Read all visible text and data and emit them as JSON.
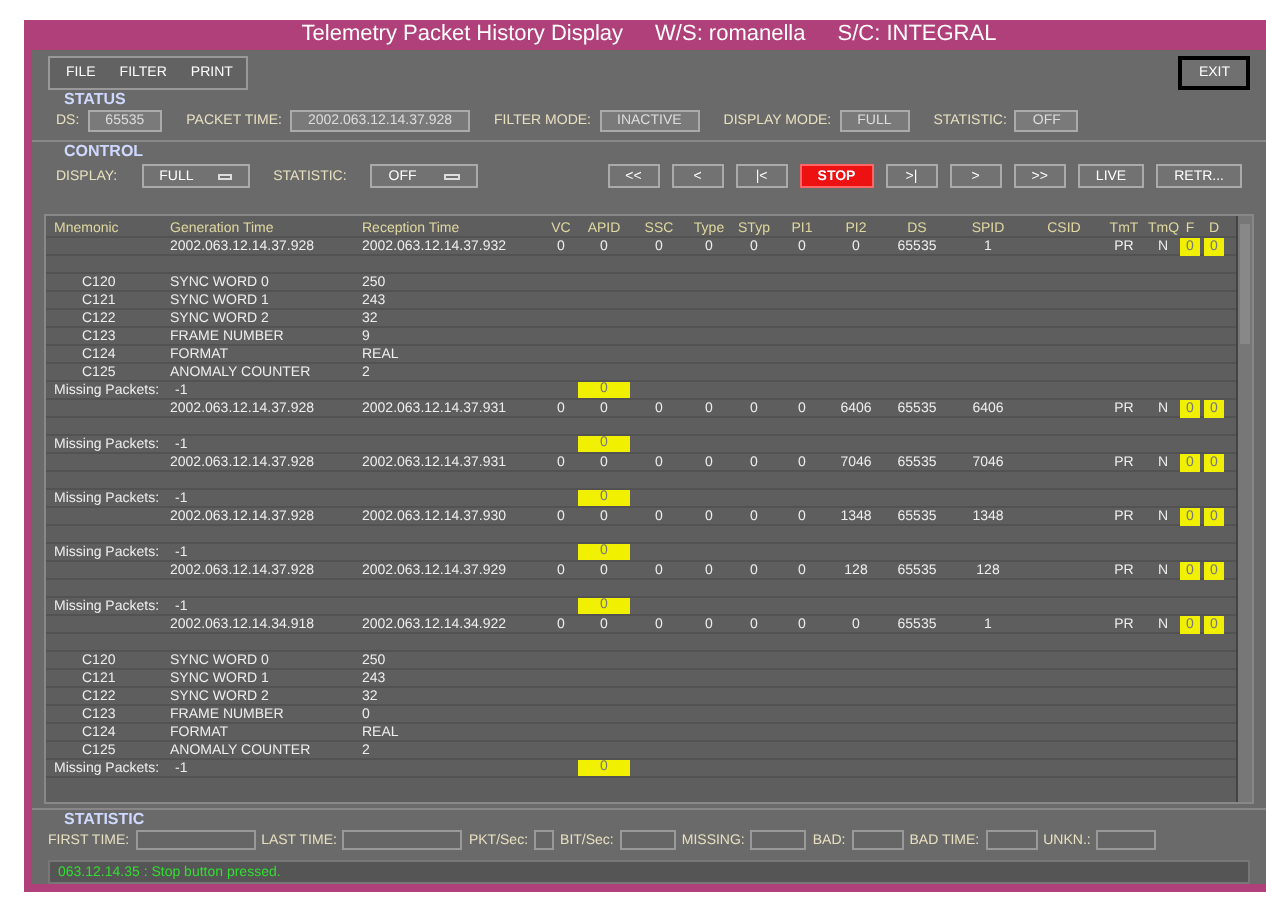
{
  "window": {
    "title": "Telemetry Packet History Display",
    "ws": "W/S: romanella",
    "sc": "S/C: INTEGRAL"
  },
  "menu": [
    "FILE",
    "FILTER",
    "PRINT"
  ],
  "exit": "EXIT",
  "status": {
    "title": "STATUS",
    "fields": [
      {
        "label": "DS:",
        "value": "65535"
      },
      {
        "label": "PACKET TIME:",
        "value": "2002.063.12.14.37.928"
      },
      {
        "label": "FILTER MODE:",
        "value": "INACTIVE"
      },
      {
        "label": "DISPLAY MODE:",
        "value": "FULL"
      },
      {
        "label": "STATISTIC:",
        "value": "OFF"
      }
    ]
  },
  "control": {
    "title": "CONTROL",
    "options": [
      {
        "label": "DISPLAY:",
        "value": "FULL"
      },
      {
        "label": "STATISTIC:",
        "value": "OFF"
      }
    ],
    "buttons": [
      {
        "label": "<<",
        "active": false
      },
      {
        "label": "<",
        "active": false
      },
      {
        "label": "|<",
        "active": false
      },
      {
        "label": "STOP",
        "active": true
      },
      {
        "label": ">|",
        "active": false
      },
      {
        "label": ">",
        "active": false
      },
      {
        "label": ">>",
        "active": false
      },
      {
        "label": "LIVE",
        "active": false
      },
      {
        "label": "RETR...",
        "active": false
      }
    ]
  },
  "table": {
    "columns": [
      "Mnemonic",
      "Generation Time",
      "Reception Time",
      "VC",
      "APID",
      "SSC",
      "Type",
      "STyp",
      "PI1",
      "PI2",
      "DS",
      "SPID",
      "CSID",
      "TmT",
      "TmQ",
      "F",
      "D"
    ],
    "rows": [
      {
        "kind": "packet",
        "cells": [
          "",
          "2002.063.12.14.37.928",
          "2002.063.12.14.37.932",
          "0",
          "0",
          "0",
          "0",
          "0",
          "0",
          "0",
          "65535",
          "1",
          "",
          "PR",
          "N",
          "0",
          "0"
        ]
      },
      {
        "kind": "blank"
      },
      {
        "kind": "param",
        "mnemonic": "C120",
        "name": "SYNC WORD 0",
        "value": "250"
      },
      {
        "kind": "param",
        "mnemonic": "C121",
        "name": "SYNC WORD 1",
        "value": "243"
      },
      {
        "kind": "param",
        "mnemonic": "C122",
        "name": "SYNC WORD 2",
        "value": "32"
      },
      {
        "kind": "param",
        "mnemonic": "C123",
        "name": "FRAME NUMBER",
        "value": "9"
      },
      {
        "kind": "param",
        "mnemonic": "C124",
        "name": "FORMAT",
        "value": "REAL"
      },
      {
        "kind": "param",
        "mnemonic": "C125",
        "name": "ANOMALY COUNTER",
        "value": "2"
      },
      {
        "kind": "missing",
        "label": "Missing Packets:",
        "count": "-1",
        "flag": "0"
      },
      {
        "kind": "packet",
        "cells": [
          "",
          "2002.063.12.14.37.928",
          "2002.063.12.14.37.931",
          "0",
          "0",
          "0",
          "0",
          "0",
          "0",
          "6406",
          "65535",
          "6406",
          "",
          "PR",
          "N",
          "0",
          "0"
        ]
      },
      {
        "kind": "blank"
      },
      {
        "kind": "missing",
        "label": "Missing Packets:",
        "count": "-1",
        "flag": "0"
      },
      {
        "kind": "packet",
        "cells": [
          "",
          "2002.063.12.14.37.928",
          "2002.063.12.14.37.931",
          "0",
          "0",
          "0",
          "0",
          "0",
          "0",
          "7046",
          "65535",
          "7046",
          "",
          "PR",
          "N",
          "0",
          "0"
        ]
      },
      {
        "kind": "blank"
      },
      {
        "kind": "missing",
        "label": "Missing Packets:",
        "count": "-1",
        "flag": "0"
      },
      {
        "kind": "packet",
        "cells": [
          "",
          "2002.063.12.14.37.928",
          "2002.063.12.14.37.930",
          "0",
          "0",
          "0",
          "0",
          "0",
          "0",
          "1348",
          "65535",
          "1348",
          "",
          "PR",
          "N",
          "0",
          "0"
        ]
      },
      {
        "kind": "blank"
      },
      {
        "kind": "missing",
        "label": "Missing Packets:",
        "count": "-1",
        "flag": "0"
      },
      {
        "kind": "packet",
        "cells": [
          "",
          "2002.063.12.14.37.928",
          "2002.063.12.14.37.929",
          "0",
          "0",
          "0",
          "0",
          "0",
          "0",
          "128",
          "65535",
          "128",
          "",
          "PR",
          "N",
          "0",
          "0"
        ]
      },
      {
        "kind": "blank"
      },
      {
        "kind": "missing",
        "label": "Missing Packets:",
        "count": "-1",
        "flag": "0"
      },
      {
        "kind": "packet",
        "cells": [
          "",
          "2002.063.12.14.34.918",
          "2002.063.12.14.34.922",
          "0",
          "0",
          "0",
          "0",
          "0",
          "0",
          "0",
          "65535",
          "1",
          "",
          "PR",
          "N",
          "0",
          "0"
        ]
      },
      {
        "kind": "blank"
      },
      {
        "kind": "param",
        "mnemonic": "C120",
        "name": "SYNC WORD 0",
        "value": "250"
      },
      {
        "kind": "param",
        "mnemonic": "C121",
        "name": "SYNC WORD 1",
        "value": "243"
      },
      {
        "kind": "param",
        "mnemonic": "C122",
        "name": "SYNC WORD 2",
        "value": "32"
      },
      {
        "kind": "param",
        "mnemonic": "C123",
        "name": "FRAME NUMBER",
        "value": "0"
      },
      {
        "kind": "param",
        "mnemonic": "C124",
        "name": "FORMAT",
        "value": "REAL"
      },
      {
        "kind": "param",
        "mnemonic": "C125",
        "name": "ANOMALY COUNTER",
        "value": "2"
      },
      {
        "kind": "missing",
        "label": "Missing Packets:",
        "count": "-1",
        "flag": "0"
      }
    ]
  },
  "statistic": {
    "title": "STATISTIC",
    "fields": [
      "FIRST TIME:",
      "LAST TIME:",
      "PKT/Sec:",
      "BIT/Sec:",
      "MISSING:",
      "BAD:",
      "BAD TIME:",
      "UNKN.:"
    ]
  },
  "message": "063.12.14.35 : Stop button pressed."
}
